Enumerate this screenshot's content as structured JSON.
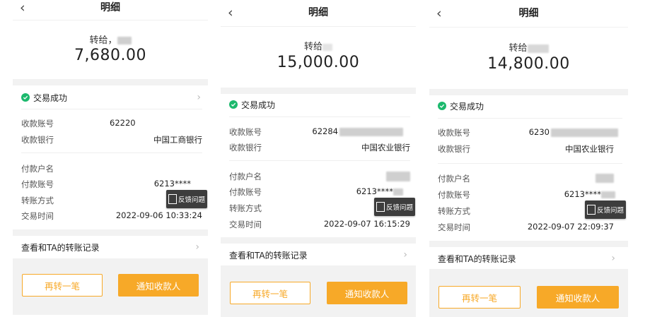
{
  "receipts": [
    {
      "back_glyph": "‹",
      "title": "明细",
      "payee_prefix": "转给，",
      "amount": "7,680.00",
      "status": "交易成功",
      "payee_account_label": "收款账号",
      "payee_account_value": "62220",
      "payee_bank_label": "收款银行",
      "payee_bank_value": "中国工商银行",
      "payer_name_label": "付款户名",
      "payer_account_label": "付款账号",
      "payer_account_value": "6213****",
      "transfer_method_label": "转账方式",
      "time_label": "交易时间",
      "time_value": "2022-09-06 10:33:24",
      "feedback_label": "反馈问题",
      "history_label": "查看和TA的转账记录",
      "again_button": "再转一笔",
      "notify_button": "通知收款人"
    },
    {
      "back_glyph": "‹",
      "title": "明细",
      "payee_prefix": "转给",
      "amount": "15,000.00",
      "status": "交易成功",
      "payee_account_label": "收款账号",
      "payee_account_value": "62284",
      "payee_bank_label": "收款银行",
      "payee_bank_value": "中国农业银行",
      "payer_name_label": "付款户名",
      "payer_account_label": "付款账号",
      "payer_account_value": "6213****",
      "transfer_method_label": "转账方式",
      "time_label": "交易时间",
      "time_value": "2022-09-07 16:15:29",
      "feedback_label": "反馈问题",
      "history_label": "查看和TA的转账记录",
      "again_button": "再转一笔",
      "notify_button": "通知收款人"
    },
    {
      "back_glyph": "‹",
      "title": "明细",
      "payee_prefix": "转给",
      "amount": "14,800.00",
      "status": "交易成功",
      "payee_account_label": "收款账号",
      "payee_account_value": "6230",
      "payee_bank_label": "收款银行",
      "payee_bank_value": "中国农业银行",
      "payer_name_label": "付款户名",
      "payer_account_label": "付款账号",
      "payer_account_value": "6213****",
      "transfer_method_label": "转账方式",
      "time_label": "交易时间",
      "time_value": "2022-09-07 22:09:37",
      "feedback_label": "反馈问题",
      "history_label": "查看和TA的转账记录",
      "again_button": "再转一笔",
      "notify_button": "通知收款人"
    }
  ],
  "colors": {
    "accent_orange": "#f7a928",
    "success_green": "#1cb96d",
    "divider_gray": "#f2f2f2"
  },
  "icons": [
    "back-arrow-icon",
    "check-circle-icon",
    "chevron-right-icon",
    "feedback-icon"
  ]
}
